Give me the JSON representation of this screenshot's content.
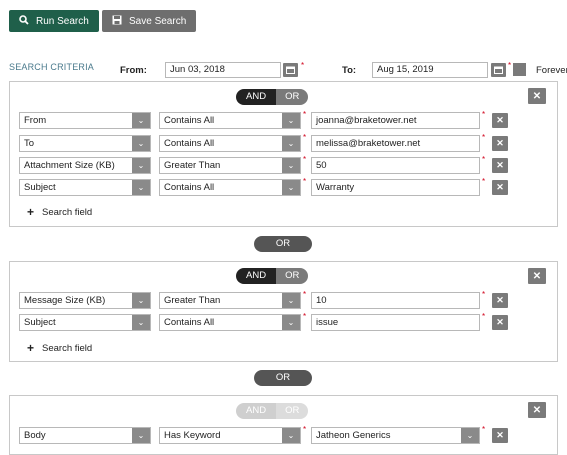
{
  "toolbar": {
    "run_label": "Run Search",
    "save_label": "Save Search"
  },
  "criteria": {
    "title": "SEARCH CRITERIA",
    "from_label": "From:",
    "from_value": "Jun 03, 2018",
    "to_label": "To:",
    "to_value": "Aug 15, 2019",
    "forever_label": "Forever"
  },
  "groups": [
    {
      "and_label": "AND",
      "or_label": "OR",
      "rows": [
        {
          "field": "From",
          "operator": "Contains All",
          "value": "joanna@braketower.net"
        },
        {
          "field": "To",
          "operator": "Contains All",
          "value": "melissa@braketower.net"
        },
        {
          "field": "Attachment Size (KB)",
          "operator": "Greater Than",
          "value": "50"
        },
        {
          "field": "Subject",
          "operator": "Contains All",
          "value": "Warranty"
        }
      ],
      "add_label": "Search field"
    },
    {
      "and_label": "AND",
      "or_label": "OR",
      "rows": [
        {
          "field": "Message Size (KB)",
          "operator": "Greater Than",
          "value": "10"
        },
        {
          "field": "Subject",
          "operator": "Contains All",
          "value": "issue"
        }
      ],
      "add_label": "Search field"
    },
    {
      "and_label": "AND",
      "or_label": "OR",
      "rows": [
        {
          "field": "Body",
          "operator": "Has Keyword",
          "value": "Jatheon Generics"
        }
      ]
    }
  ],
  "connectors": [
    "OR",
    "OR"
  ],
  "icons": {
    "run": "search-icon",
    "save": "save-icon",
    "calendar": "calendar-icon",
    "close": "close-icon",
    "chevron": "chevron-down-icon",
    "plus": "plus-icon"
  },
  "colors": {
    "primary": "#1f5f4a",
    "secondary": "#6e6e6e",
    "criteria_label": "#4a7a8c",
    "required": "#d0021b"
  }
}
